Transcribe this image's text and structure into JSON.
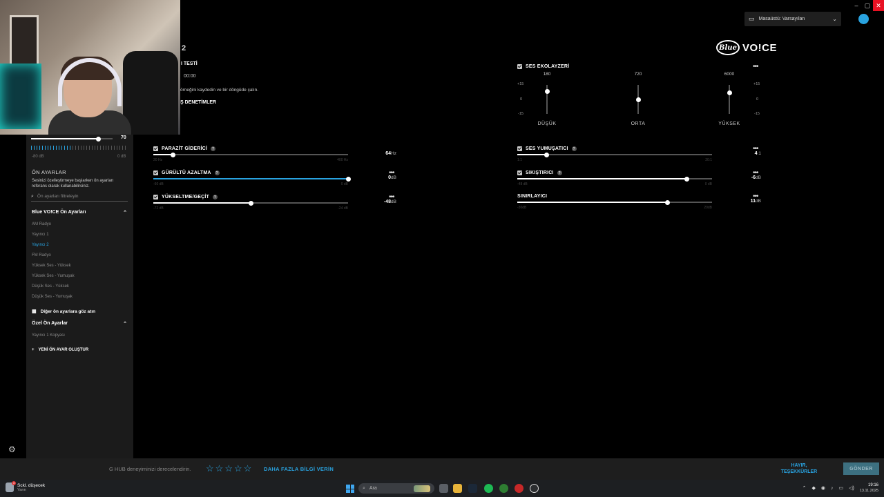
{
  "window": {
    "controls": [
      "–",
      "▢",
      "✕"
    ]
  },
  "device_selector": {
    "label": "Masaüstü: Varsayılan"
  },
  "brand": {
    "mark": "Blue",
    "word": "VO!CE"
  },
  "header": {
    "preset_suffix": "2",
    "test_label": "I TESTİ",
    "timer": "00:00",
    "record_hint": "örneğini kaydedin ve bir döngüde çalın.",
    "controls_label": "Ş DENETİMLER"
  },
  "sidebar": {
    "mic_level": {
      "value": "70",
      "min": "-80 dB",
      "max": "0 dB",
      "level": 0.82
    },
    "presets_title": "ÖN AYARLAR",
    "presets_desc": "Sesinizi özelleştirmeye başlarken ön ayarları referans olarak kullanabilirsiniz.",
    "search_placeholder": "Ön ayarları filtreleyin",
    "blue_section": "Blue VO!CE Ön Ayarları",
    "blue_items": [
      "AM Radyo",
      "Yayıncı 1",
      "Yayıncı 2",
      "FM Radyo",
      "Yüksek Ses - Yüksek",
      "Yüksek Ses - Yumuşak",
      "Düşük Ses - Yüksek",
      "Düşük Ses - Yumuşak"
    ],
    "active_item": "Yayıncı 2",
    "browse_more": "Diğer ön ayarlara göz atın",
    "custom_section": "Özel Ön Ayarlar",
    "custom_items": [
      "Yayıncı 1 Kopyası"
    ],
    "create_new": "YENİ ÖN AYAR OLUŞTUR"
  },
  "controls_left": [
    {
      "label": "PARAZİT GİDERİCİ",
      "value": "64",
      "unit": "Hz",
      "min": "20 Hz",
      "max": "400 Hz",
      "level": 0.1,
      "help": true,
      "menu": false
    },
    {
      "label": "GÜRÜLTÜ AZALTMA",
      "value": "0",
      "unit": "dB",
      "min": "-60 dB",
      "max": "0 dB",
      "level": 1.0,
      "help": true,
      "menu": true
    },
    {
      "label": "YÜKSELTME/GEÇİT",
      "value": "-48",
      "unit": "dB",
      "min": "-72 dB",
      "max": "-24 dB",
      "level": 0.5,
      "help": true,
      "menu": true
    }
  ],
  "equalizer": {
    "label": "SES EKOLAYZERİ",
    "scale_left": [
      "+15",
      "0",
      "-15"
    ],
    "scale_right": [
      "+15",
      "0",
      "-15"
    ],
    "bands": [
      {
        "freq": "180",
        "name": "DÜŞÜK",
        "gain": 8
      },
      {
        "freq": "720",
        "name": "ORTA",
        "gain": 0
      },
      {
        "freq": "6000",
        "name": "YÜKSEK",
        "gain": 7
      }
    ]
  },
  "controls_right": [
    {
      "label": "SES YUMUŞATICI",
      "value": "4",
      "unit": ":1",
      "min": "1:1",
      "max": "20:1",
      "level": 0.15,
      "help": true,
      "menu": true,
      "check": true
    },
    {
      "label": "SIKIŞTIRICI",
      "value": "-6",
      "unit": "dB",
      "min": "-48 dB",
      "max": "0 dB",
      "level": 0.87,
      "help": true,
      "menu": true,
      "check": true
    },
    {
      "label": "SINIRLAYICI",
      "value": "11",
      "unit": "dB",
      "min": "-30dB",
      "max": "20dB",
      "level": 0.77,
      "help": false,
      "menu": true,
      "check": false
    }
  ],
  "rating_bar": {
    "prompt": "G HUB deneyiminizi derecelendirin.",
    "more_info": "DAHA FAZLA BİLGİ VERİN",
    "no_thanks_line1": "HAYIR,",
    "no_thanks_line2": "TEŞEKKÜRLER",
    "send": "GÖNDER",
    "stars": 5
  },
  "taskbar": {
    "weather_title": "Sckl. düşecek",
    "weather_sub": "Yarın",
    "weather_badge": "3",
    "search_placeholder": "Ara",
    "time": "19:16",
    "date": "13.11.2025"
  },
  "colors": {
    "accent": "#29a3e0",
    "close": "#e81123",
    "panel": "#1b1b1b"
  }
}
